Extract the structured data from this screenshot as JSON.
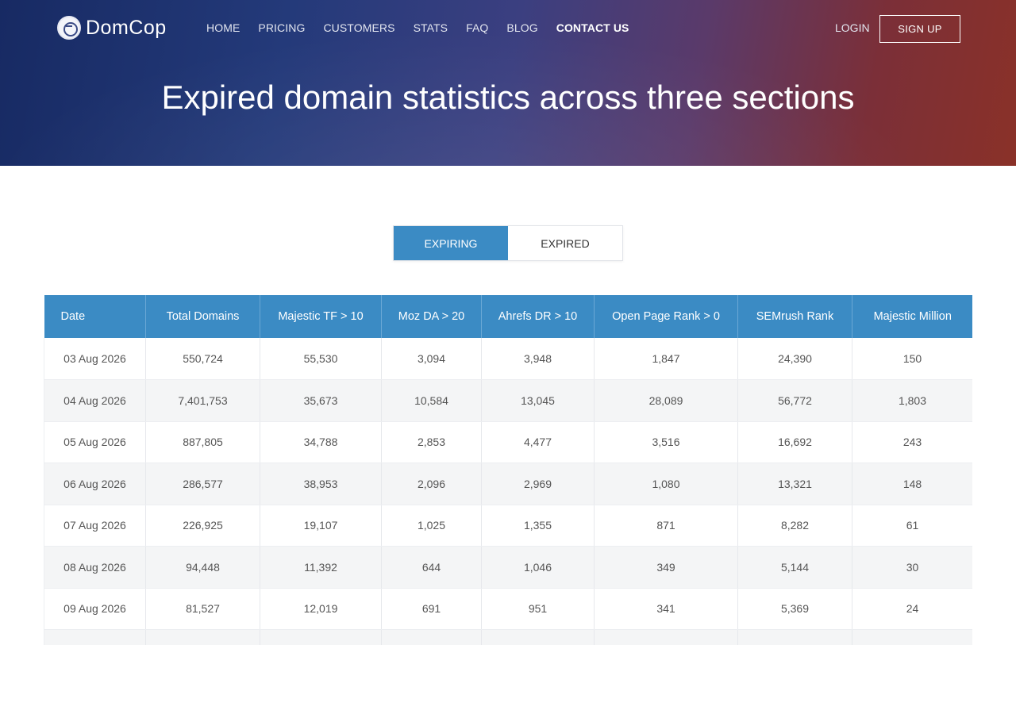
{
  "header": {
    "logo_text": "DomCop",
    "nav": [
      "HOME",
      "PRICING",
      "CUSTOMERS",
      "STATS",
      "FAQ",
      "BLOG",
      "CONTACT US"
    ],
    "login": "LOGIN",
    "signup": "SIGN UP"
  },
  "hero": {
    "title": "Expired domain statistics across three sections"
  },
  "toggle": {
    "options": [
      "EXPIRING",
      "EXPIRED"
    ],
    "active": "EXPIRING"
  },
  "table": {
    "columns": [
      "Date",
      "Total Domains",
      "Majestic TF > 10",
      "Moz DA > 20",
      "Ahrefs DR > 10",
      "Open Page Rank > 0",
      "SEMrush Rank",
      "Majestic Million"
    ],
    "rows": [
      [
        "03 Aug 2026",
        "550,724",
        "55,530",
        "3,094",
        "3,948",
        "1,847",
        "24,390",
        "150"
      ],
      [
        "04 Aug 2026",
        "7,401,753",
        "35,673",
        "10,584",
        "13,045",
        "28,089",
        "56,772",
        "1,803"
      ],
      [
        "05 Aug 2026",
        "887,805",
        "34,788",
        "2,853",
        "4,477",
        "3,516",
        "16,692",
        "243"
      ],
      [
        "06 Aug 2026",
        "286,577",
        "38,953",
        "2,096",
        "2,969",
        "1,080",
        "13,321",
        "148"
      ],
      [
        "07 Aug 2026",
        "226,925",
        "19,107",
        "1,025",
        "1,355",
        "871",
        "8,282",
        "61"
      ],
      [
        "08 Aug 2026",
        "94,448",
        "11,392",
        "644",
        "1,046",
        "349",
        "5,144",
        "30"
      ],
      [
        "09 Aug 2026",
        "81,527",
        "12,019",
        "691",
        "951",
        "341",
        "5,369",
        "24"
      ],
      [
        "",
        "",
        "",
        "",
        "",
        "",
        "",
        ""
      ]
    ]
  },
  "colors": {
    "accent": "#3b8bc4",
    "hero_left": "#172a63",
    "hero_right": "#8a3128"
  }
}
